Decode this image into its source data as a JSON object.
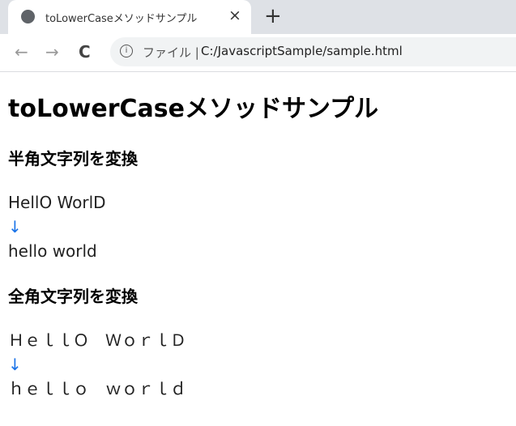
{
  "browser": {
    "tab_title": "toLowerCaseメソッドサンプル",
    "close_icon": "×",
    "new_tab_icon": "+",
    "back_icon": "←",
    "forward_icon": "→",
    "reload_icon": "C",
    "info_icon": "i",
    "file_label": "ファイル",
    "separator": "|",
    "url": "C:/JavascriptSample/sample.html"
  },
  "page": {
    "title": "toLowerCaseメソッドサンプル",
    "sections": [
      {
        "heading": "半角文字列を変換",
        "input": "HellO WorlD",
        "arrow": "↓",
        "output": "hello world"
      },
      {
        "heading": "全角文字列を変換",
        "input": "ＨｅｌｌＯ　ＷｏｒｌＤ",
        "arrow": "↓",
        "output": "ｈｅｌｌｏ　ｗｏｒｌｄ"
      }
    ]
  },
  "colors": {
    "arrow": "#1a73e8",
    "tabbar": "#dee1e6",
    "omnibox": "#f1f3f4"
  }
}
